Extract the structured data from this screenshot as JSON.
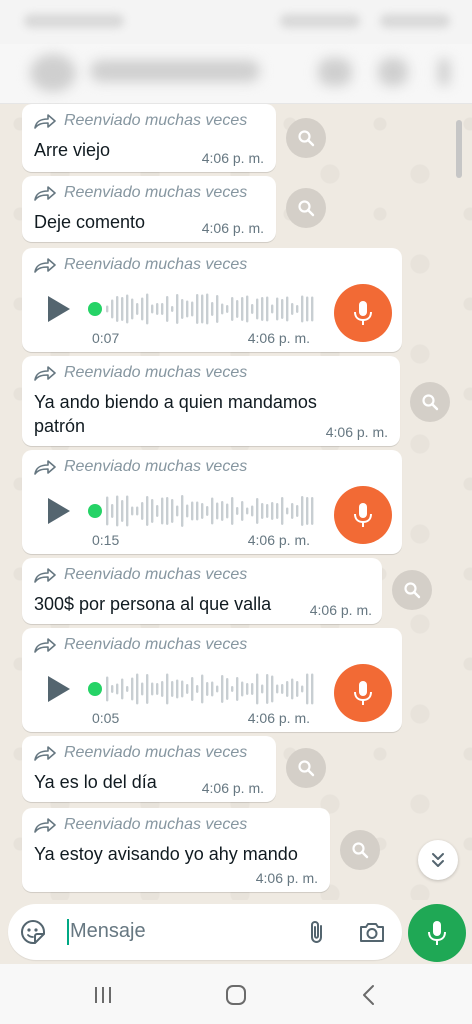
{
  "chat": {
    "forward_label": "Reenviado muchas veces",
    "messages": [
      {
        "type": "text",
        "text": "Arre viejo",
        "time": "4:06 p. m."
      },
      {
        "type": "text",
        "text": "Deje comento",
        "time": "4:06 p. m."
      },
      {
        "type": "voice",
        "duration": "0:07",
        "time": "4:06 p. m."
      },
      {
        "type": "text",
        "text": "Ya ando biendo a quien mandamos patrón",
        "time": "4:06 p. m."
      },
      {
        "type": "voice",
        "duration": "0:15",
        "time": "4:06 p. m."
      },
      {
        "type": "text",
        "text": "300$ por persona al que valla",
        "time": "4:06 p. m."
      },
      {
        "type": "voice",
        "duration": "0:05",
        "time": "4:06 p. m."
      },
      {
        "type": "text",
        "text": "Ya es lo del día",
        "time": "4:06 p. m."
      },
      {
        "type": "text",
        "text": "Ya estoy avisando yo ahy mando",
        "time": "4:06 p. m."
      }
    ]
  },
  "composer": {
    "placeholder": "Mensaje"
  },
  "icons": {
    "forward": "forward-arrow-icon",
    "search": "search-icon",
    "play": "play-icon",
    "mic": "microphone-icon",
    "scroll_down": "double-chevron-down-icon",
    "sticker": "sticker-icon",
    "attach": "paperclip-icon",
    "camera": "camera-icon",
    "nav_recents": "recents-icon",
    "nav_home": "home-icon",
    "nav_back": "back-icon"
  },
  "colors": {
    "voice_mic": "#f26a35",
    "send_mic": "#1fa855",
    "playback_dot": "#25d366",
    "wallpaper": "#efeae2"
  }
}
